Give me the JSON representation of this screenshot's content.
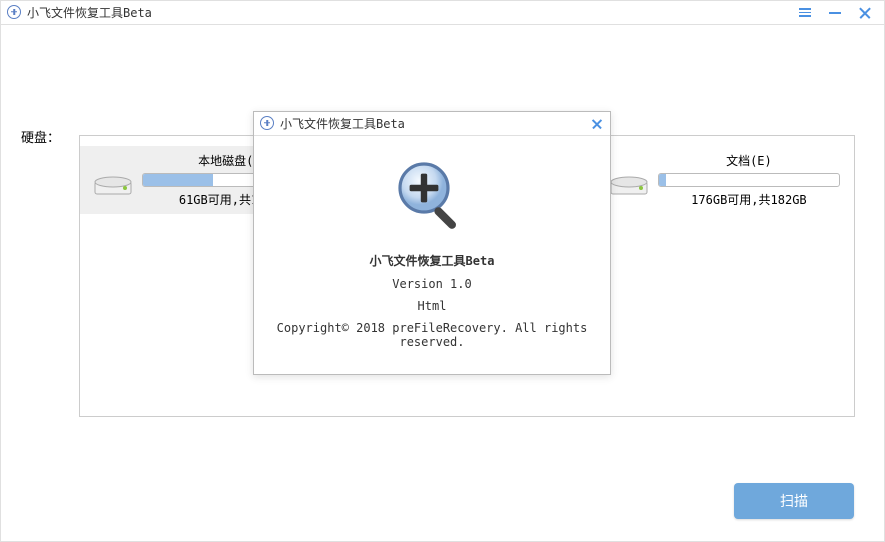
{
  "window": {
    "title": "小飞文件恢复工具Beta"
  },
  "disks": {
    "label": "硬盘：",
    "items": [
      {
        "name": "本地磁盘(C)",
        "usage": "61GB可用,共100GB",
        "fill_pct": 39
      },
      {
        "name": "",
        "usage": "",
        "fill_pct": 0
      },
      {
        "name": "文档(E)",
        "usage": "176GB可用,共182GB",
        "fill_pct": 4
      }
    ]
  },
  "scan_button": "扫描",
  "about": {
    "title": "小飞文件恢复工具Beta",
    "app_name": "小飞文件恢复工具Beta",
    "version": "Version 1.0",
    "format": "Html",
    "copyright": "Copyright© 2018 preFileRecovery. All rights reserved."
  }
}
